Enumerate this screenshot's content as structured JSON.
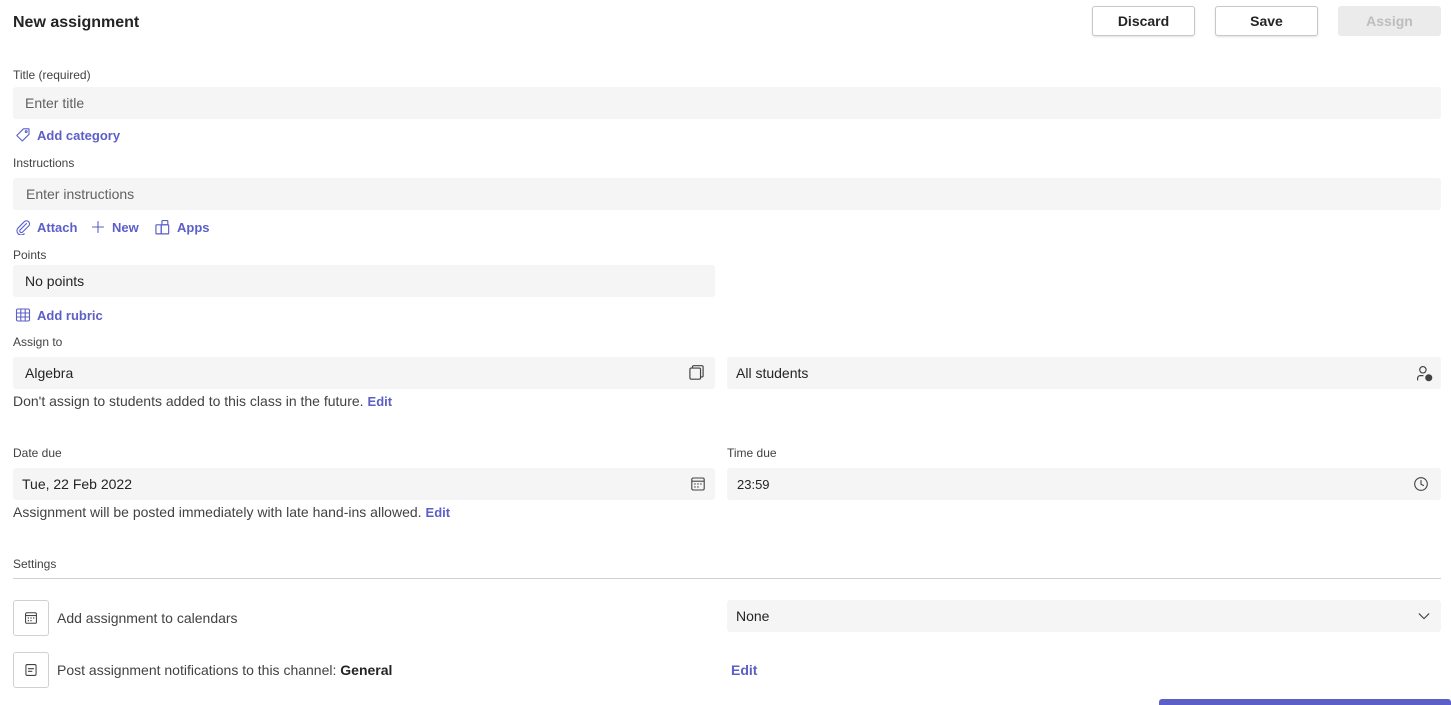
{
  "header": {
    "title": "New assignment",
    "discard_label": "Discard",
    "save_label": "Save",
    "assign_label": "Assign"
  },
  "title_section": {
    "label": "Title (required)",
    "placeholder": "Enter title",
    "add_category_label": "Add category"
  },
  "instructions_section": {
    "label": "Instructions",
    "placeholder": "Enter instructions",
    "attach_label": "Attach",
    "new_label": "New",
    "apps_label": "Apps"
  },
  "points_section": {
    "label": "Points",
    "value": "No points",
    "add_rubric_label": "Add rubric"
  },
  "assign_to_section": {
    "label": "Assign to",
    "class_value": "Algebra",
    "students_value": "All students",
    "helper_text": "Don't assign to students added to this class in the future.",
    "edit_label": "Edit"
  },
  "due_section": {
    "date_label": "Date due",
    "date_value": "Tue, 22 Feb 2022",
    "time_label": "Time due",
    "time_value": "23:59",
    "helper_text": "Assignment will be posted immediately with late hand-ins allowed.",
    "edit_label": "Edit"
  },
  "settings_section": {
    "label": "Settings",
    "calendar_setting": "Add assignment to calendars",
    "calendar_value": "None",
    "channel_setting_prefix": "Post assignment notifications to this channel:",
    "channel_name": "General",
    "channel_edit_label": "Edit"
  },
  "colors": {
    "accent": "#5b5fc7",
    "field_bg": "#f5f5f5",
    "disabled_bg": "#ebebeb"
  },
  "icons": {
    "tag": "tag-icon",
    "attach": "paperclip-icon",
    "new": "plus-icon",
    "apps": "apps-icon",
    "rubric": "grid-icon",
    "class_picker": "copy-icon",
    "students_picker": "person-settings-icon",
    "calendar": "calendar-icon",
    "clock": "clock-icon",
    "dropdown": "chevron-down-icon",
    "notification": "note-icon"
  }
}
